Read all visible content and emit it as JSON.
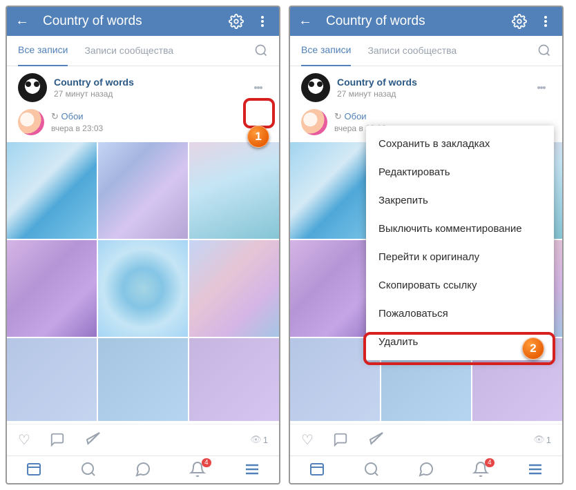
{
  "header": {
    "title": "Country of words"
  },
  "tabs": {
    "all": "Все записи",
    "community": "Записи сообщества"
  },
  "post": {
    "author": "Country of words",
    "time": "27 минут назад"
  },
  "repost": {
    "label": "Обои",
    "time": "вчера в 23:03"
  },
  "views": "1",
  "nav": {
    "badge": "4"
  },
  "menu": {
    "bookmark": "Сохранить в закладках",
    "edit": "Редактировать",
    "pin": "Закрепить",
    "disable_comments": "Выключить комментирование",
    "original": "Перейти к оригиналу",
    "copy": "Скопировать ссылку",
    "report": "Пожаловаться",
    "delete": "Удалить"
  },
  "callouts": {
    "one": "1",
    "two": "2"
  }
}
